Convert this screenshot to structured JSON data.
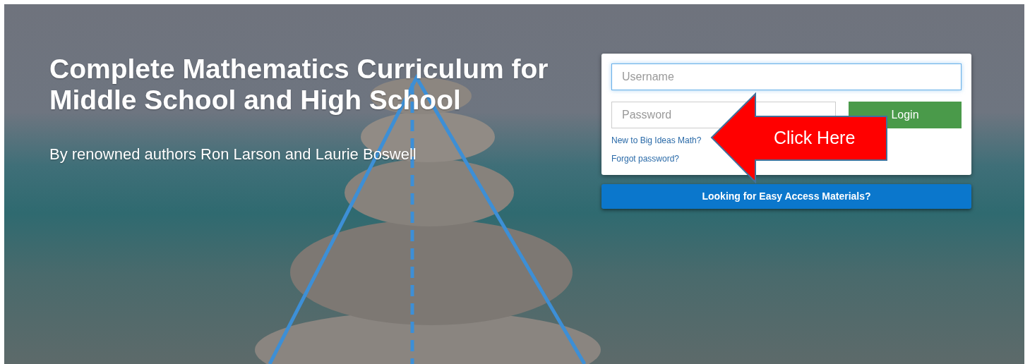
{
  "hero": {
    "title_lines": [
      "Complete Mathematics Curriculum for",
      "Middle School and High School"
    ],
    "subtitle": "By renowned authors Ron Larson and Laurie Boswell"
  },
  "login": {
    "username": {
      "placeholder": "Username",
      "focused": true
    },
    "password": {
      "placeholder": "Password",
      "focused": false
    },
    "login_button": "Login",
    "links": [
      "New to Big Ideas Math?",
      "Forgot password?"
    ]
  },
  "easy_access_button": "Looking for Easy Access Materials?",
  "callout": {
    "label": "Click Here"
  }
}
